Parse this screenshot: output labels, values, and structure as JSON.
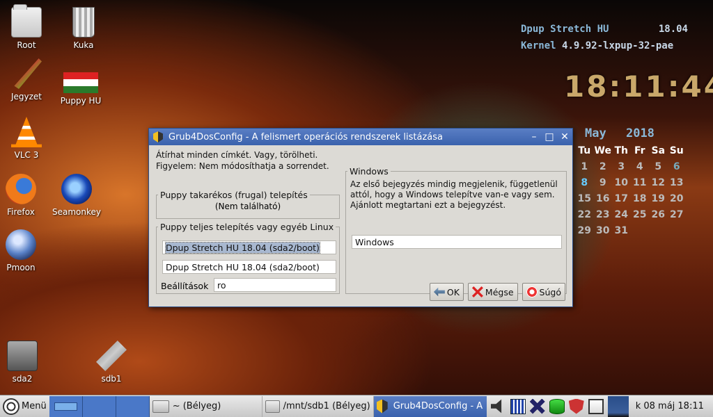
{
  "desktop": {
    "icons": [
      {
        "label": "Root",
        "icon": "folder-icon"
      },
      {
        "label": "Kuka",
        "icon": "trash-icon"
      },
      {
        "label": "Jegyzet",
        "icon": "quill-icon"
      },
      {
        "label": "Puppy HU",
        "icon": "hungarian-flag-icon"
      },
      {
        "label": "VLC 3",
        "icon": "vlc-cone-icon"
      },
      {
        "label": "Firefox",
        "icon": "firefox-icon"
      },
      {
        "label": "Seamonkey",
        "icon": "seamonkey-icon"
      },
      {
        "label": "Pmoon",
        "icon": "moon-icon"
      },
      {
        "label": "sda2",
        "icon": "hard-drive-icon"
      },
      {
        "label": "sdb1",
        "icon": "usb-drive-icon"
      }
    ]
  },
  "conky": {
    "distro_name": "Dpup Stretch HU",
    "distro_version": "18.04",
    "kernel_label": "Kernel",
    "kernel_version": "4.9.92-lxpup-32-pae",
    "time": "18:11:44",
    "calendar": {
      "month": "May",
      "year": "2018",
      "weekdays": [
        "Tu",
        "We",
        "Th",
        "Fr",
        "Sa",
        "Su"
      ],
      "weeks": [
        [
          "1",
          "2",
          "3",
          "4",
          "5",
          "6"
        ],
        [
          "8",
          "9",
          "10",
          "11",
          "12",
          "13"
        ],
        [
          "15",
          "16",
          "17",
          "18",
          "19",
          "20"
        ],
        [
          "22",
          "23",
          "24",
          "25",
          "26",
          "27"
        ],
        [
          "29",
          "30",
          "31",
          "",
          "",
          ""
        ]
      ],
      "today": "8"
    }
  },
  "dialog": {
    "title": "Grub4DosConfig - A felismert operációs rendszerek listázása",
    "intro_line1": "Átírhat minden címkét. Vagy, törölheti.",
    "intro_line2": "Figyelem: Nem módosíthatja a sorrendet.",
    "frugal": {
      "legend": "Puppy takarékos (frugal) telepítés",
      "none_text": "(Nem található)"
    },
    "full": {
      "legend": "Puppy teljes telepítés vagy egyéb Linux",
      "entry1": "Dpup Stretch HU 18.04 (sda2/boot)",
      "entry2": "Dpup Stretch HU 18.04 (sda2/boot)",
      "settings_label": "Beállítások",
      "settings_value": "ro"
    },
    "windows": {
      "legend": "Windows",
      "description": "Az első bejegyzés mindig megjelenik, függetlenül attól, hogy a Windows telepítve van-e vagy sem. Ajánlott megtartani ezt a bejegyzést.",
      "entry": "Windows"
    },
    "buttons": {
      "ok": "OK",
      "cancel": "Mégse",
      "help": "Súgó"
    }
  },
  "taskbar": {
    "menu_label": "Menü",
    "tasks": [
      "~ (Bélyeg)",
      "/mnt/sdb1 (Bélyeg)",
      "Grub4DosConfig - A"
    ],
    "clock": "k 08 máj 18:11"
  }
}
